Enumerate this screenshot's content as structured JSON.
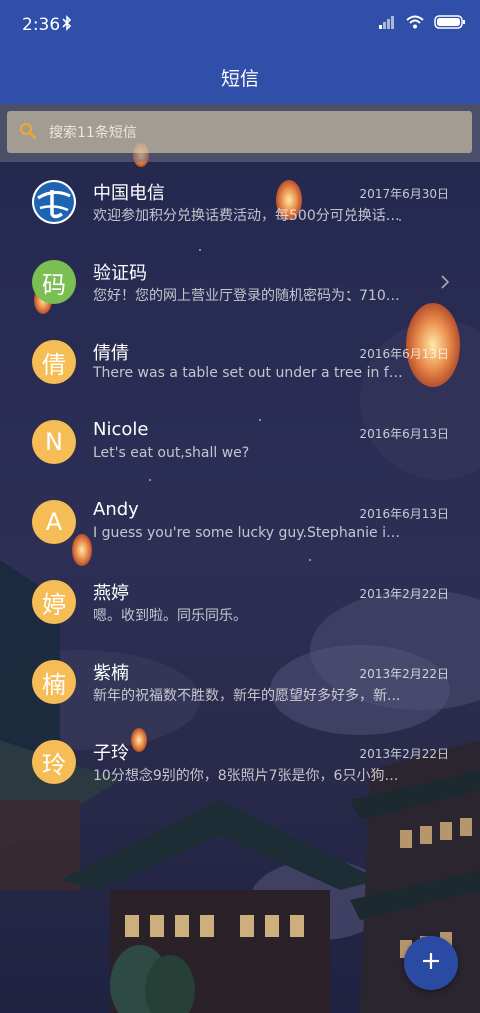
{
  "status_bar": {
    "time": "2:36"
  },
  "app_bar": {
    "title": "短信"
  },
  "search": {
    "placeholder": "搜索11条短信"
  },
  "conversations": [
    {
      "name": "中国电信",
      "date": "2017年6月30日",
      "preview": "欢迎参加积分兑换话费活动，每500分可兑换话费...",
      "avatar_type": "logo"
    },
    {
      "name": "验证码",
      "date": "",
      "preview": "您好！您的网上营业厅登录的随机密码为：7106...",
      "avatar_text": "码",
      "avatar_color": "#7bbe54",
      "chevron": true
    },
    {
      "name": "倩倩",
      "date": "2016年6月13日",
      "preview": "There was a table set out under a tree in fron...",
      "avatar_text": "倩",
      "avatar_color": "#f6bc55"
    },
    {
      "name": "Nicole",
      "date": "2016年6月13日",
      "preview": "Let's eat out,shall we?",
      "avatar_text": "N",
      "avatar_color": "#f6bc55"
    },
    {
      "name": "Andy",
      "date": "2016年6月13日",
      "preview": "I guess you're some lucky guy.Stephanie is a...",
      "avatar_text": "A",
      "avatar_color": "#f6bc55"
    },
    {
      "name": "燕婷",
      "date": "2013年2月22日",
      "preview": "嗯。收到啦。同乐同乐。",
      "avatar_text": "婷",
      "avatar_color": "#f6bc55"
    },
    {
      "name": "紫楠",
      "date": "2013年2月22日",
      "preview": "新年的祝福数不胜数，新年的愿望好多好多，新...",
      "avatar_text": "楠",
      "avatar_color": "#f6bc55"
    },
    {
      "name": "子玲",
      "date": "2013年2月22日",
      "preview": "10分想念9别的你，8张照片7张是你，6只小狗5...",
      "avatar_text": "玲",
      "avatar_color": "#f6bc55"
    }
  ],
  "fab": {
    "icon": "plus-icon"
  }
}
